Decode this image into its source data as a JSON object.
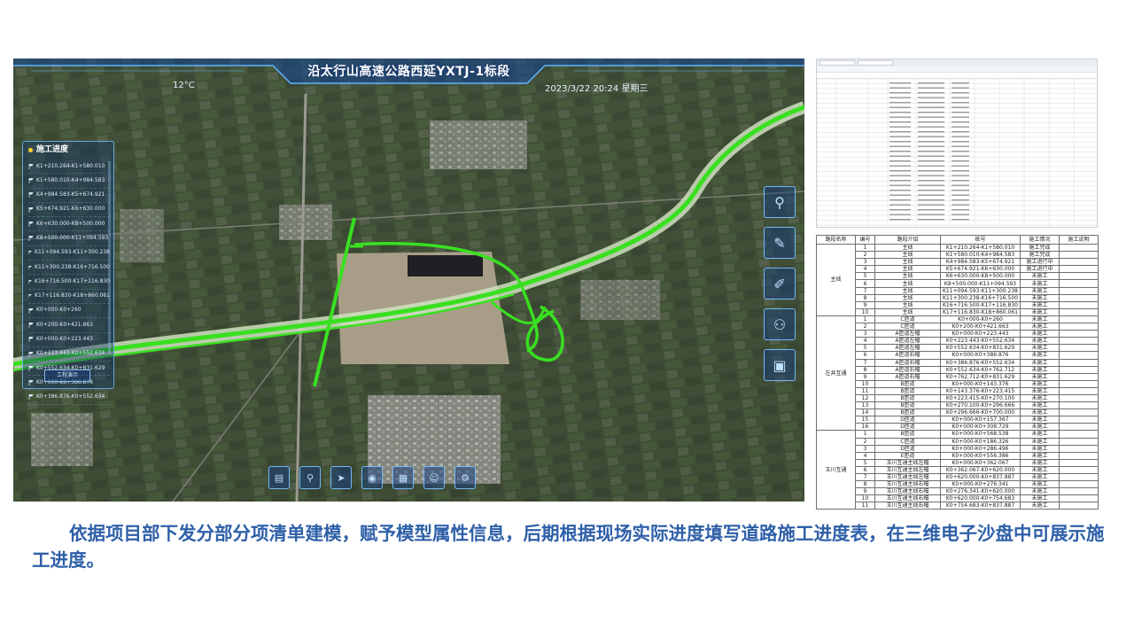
{
  "hud": {
    "title": "沿太行山高速公路西延YXTJ-1标段",
    "temperature": "12°C",
    "datetime": "2023/3/22  20:24  星期三"
  },
  "progress_panel": {
    "title": "施工进度",
    "items": [
      "K1+210.264-K1+580.010",
      "K1+580.010-K4+984.583",
      "K4+984.583-K5+674.921",
      "K5+674.921-K6+630.000",
      "K6+630.000-K8+500.000",
      "K8+500.000-K11+094.593",
      "K11+094.593-K11+300.238",
      "K11+300.238-K16+716.500",
      "K16+716.500-K17+116.830",
      "K17+116.830-K18+860.061",
      "K0+000-K0+260",
      "K0+200-K0+421.663",
      "K0+000-K0+223.443",
      "K0+223.443-K0+552.634",
      "K0+552.634-K0+831.629",
      "K0+000-K0+386.876",
      "K0+386.876-K0+552.634"
    ],
    "button_label": "工程演示"
  },
  "right_tools": [
    {
      "name": "location-icon",
      "glyph": "⚲"
    },
    {
      "name": "pencil-icon",
      "glyph": "✎"
    },
    {
      "name": "edit-icon",
      "glyph": "✐"
    },
    {
      "name": "people-icon",
      "glyph": "⚇"
    },
    {
      "name": "image-icon",
      "glyph": "▣"
    }
  ],
  "bottom_tools": [
    {
      "name": "monitor-icon",
      "glyph": "▤"
    },
    {
      "name": "pin-icon",
      "glyph": "⚲"
    },
    {
      "name": "navigation-icon",
      "glyph": "➤"
    },
    {
      "name": "camera-icon",
      "glyph": "◉"
    },
    {
      "name": "folder-icon",
      "glyph": "▦"
    },
    {
      "name": "user-icon",
      "glyph": "☺"
    },
    {
      "name": "settings-icon",
      "glyph": "⚙"
    }
  ],
  "table": {
    "headers": [
      "路段名称",
      "编号",
      "路段介绍",
      "桩号",
      "施工情况",
      "施工说明"
    ],
    "groups": [
      {
        "name": "主线",
        "rows": [
          [
            "1",
            "主线",
            "K1+210.264-K1+580.010",
            "施工完成",
            ""
          ],
          [
            "2",
            "主线",
            "K1+580.010-K4+984.583",
            "施工完成",
            ""
          ],
          [
            "3",
            "主线",
            "K4+984.583-K5+674.921",
            "施工进行中",
            ""
          ],
          [
            "4",
            "主线",
            "K5+674.921-K6+630.000",
            "施工进行中",
            ""
          ],
          [
            "5",
            "主线",
            "K6+630.000-K8+500.000",
            "未施工",
            ""
          ],
          [
            "6",
            "主线",
            "K8+500.000-K11+094.593",
            "未施工",
            ""
          ],
          [
            "7",
            "主线",
            "K11+094.593-K11+300.238",
            "未施工",
            ""
          ],
          [
            "8",
            "主线",
            "K11+300.238-K16+716.500",
            "未施工",
            ""
          ],
          [
            "9",
            "主线",
            "K16+716.500-K17+116.830",
            "未施工",
            ""
          ],
          [
            "10",
            "主线",
            "K17+116.830-K18+860.061",
            "未施工",
            ""
          ]
        ]
      },
      {
        "name": "左井互通",
        "rows": [
          [
            "1",
            "C匝道",
            "K0+000-K0+260",
            "未施工",
            ""
          ],
          [
            "2",
            "C匝道",
            "K0+200-K0+421.663",
            "未施工",
            ""
          ],
          [
            "3",
            "A匝道左幅",
            "K0+000-K0+223.443",
            "未施工",
            ""
          ],
          [
            "4",
            "A匝道左幅",
            "K0+223.443-K0+552.634",
            "未施工",
            ""
          ],
          [
            "5",
            "A匝道左幅",
            "K0+552.634-K0+831.629",
            "未施工",
            ""
          ],
          [
            "6",
            "A匝道右幅",
            "K0+000-K0+386.876",
            "未施工",
            ""
          ],
          [
            "7",
            "A匝道右幅",
            "K0+386.876-K0+552.634",
            "未施工",
            ""
          ],
          [
            "8",
            "A匝道右幅",
            "K0+552.634-K0+762.712",
            "未施工",
            ""
          ],
          [
            "9",
            "A匝道右幅",
            "K0+762.712-K0+831.629",
            "未施工",
            ""
          ],
          [
            "10",
            "B匝道",
            "K0+000-K0+143.376",
            "未施工",
            ""
          ],
          [
            "11",
            "B匝道",
            "K0+143.376-K0+223.415",
            "未施工",
            ""
          ],
          [
            "12",
            "B匝道",
            "K0+223.415-K0+270.100",
            "未施工",
            ""
          ],
          [
            "13",
            "B匝道",
            "K0+270.100-K0+296.666",
            "未施工",
            ""
          ],
          [
            "14",
            "B匝道",
            "K0+296.666-K0+700.000",
            "未施工",
            ""
          ],
          [
            "15",
            "D匝道",
            "K0+000-K0+157.367",
            "未施工",
            ""
          ],
          [
            "16",
            "D匝道",
            "K0+000-K0+308.729",
            "未施工",
            ""
          ]
        ]
      },
      {
        "name": "玉川互通",
        "rows": [
          [
            "1",
            "B匝道",
            "K0+000-K0+568.538",
            "未施工",
            ""
          ],
          [
            "2",
            "C匝道",
            "K0+000-K0+186.326",
            "未施工",
            ""
          ],
          [
            "3",
            "D匝道",
            "K0+000-K0+286.496",
            "未施工",
            ""
          ],
          [
            "4",
            "E匝道",
            "K0+000-K0+556.386",
            "未施工",
            ""
          ],
          [
            "5",
            "玉川互通主线左幅",
            "K0+000-K0+362.067",
            "未施工",
            ""
          ],
          [
            "6",
            "玉川互通主线左幅",
            "K0+362.067-K0+620.000",
            "未施工",
            ""
          ],
          [
            "7",
            "玉川互通主线左幅",
            "K0+620.000-K0+837.887",
            "未施工",
            ""
          ],
          [
            "8",
            "玉川互通主线右幅",
            "K0+000-K0+276.341",
            "未施工",
            ""
          ],
          [
            "9",
            "玉川互通主线右幅",
            "K0+276.341-K0+620.000",
            "未施工",
            ""
          ],
          [
            "10",
            "玉川互通主线右幅",
            "K0+620.000-K0+754.683",
            "未施工",
            ""
          ],
          [
            "11",
            "玉川互通主线右幅",
            "K0+754.683-K0+837.887",
            "未施工",
            ""
          ]
        ]
      }
    ]
  },
  "caption": "依据项目部下发分部分项清单建模，赋予模型属性信息，后期根据现场实际进度填写道路施工进度表，在三维电子沙盘中可展示施工进度。",
  "colors": {
    "caption": "#2e5fa8",
    "road_progress": "#39e020",
    "hud_accent": "#5fb4ff"
  }
}
